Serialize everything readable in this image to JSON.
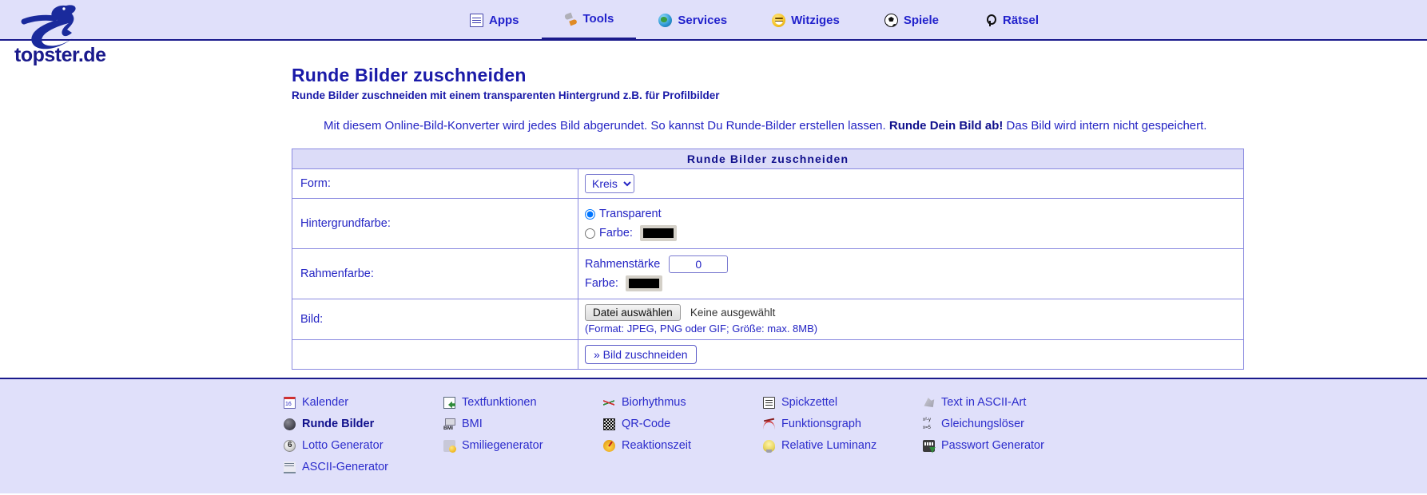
{
  "site": {
    "logo_text": "topster.de"
  },
  "nav": {
    "items": [
      {
        "label": "Apps",
        "icon": "apps-icon",
        "active": false
      },
      {
        "label": "Tools",
        "icon": "tools-icon",
        "active": true
      },
      {
        "label": "Services",
        "icon": "services-icon",
        "active": false
      },
      {
        "label": "Witziges",
        "icon": "smiley-icon",
        "active": false
      },
      {
        "label": "Spiele",
        "icon": "soccer-ball-icon",
        "active": false
      },
      {
        "label": "Rätsel",
        "icon": "puzzle-key-icon",
        "active": false
      }
    ]
  },
  "page": {
    "title": "Runde Bilder zuschneiden",
    "subtitle": "Runde Bilder zuschneiden mit einem transparenten Hintergrund z.B. für Profilbilder",
    "intro_part1": "Mit diesem Online-Bild-Konverter wird jedes Bild abgerundet. So kannst Du Runde-Bilder erstellen lassen. ",
    "intro_bold": "Runde Dein Bild ab!",
    "intro_part2": " Das Bild wird intern nicht gespeichert."
  },
  "form": {
    "header": "Runde Bilder zuschneiden",
    "rows": {
      "form": {
        "label": "Form:",
        "select_value": "Kreis",
        "options": [
          "Kreis"
        ]
      },
      "background": {
        "label": "Hintergrundfarbe:",
        "radio_transparent": "Transparent",
        "radio_farbe": "Farbe:",
        "color_value": "#000000",
        "selected": "transparent"
      },
      "border": {
        "label": "Rahmenfarbe:",
        "strength_label": "Rahmenstärke",
        "strength_value": "0",
        "color_label": "Farbe:",
        "color_value": "#000000"
      },
      "image": {
        "label": "Bild:",
        "file_button": "Datei auswählen",
        "file_status": "Keine ausgewählt",
        "hint": "(Format: JPEG, PNG oder GIF; Größe: max. 8MB)"
      }
    },
    "submit_label": "» Bild zuschneiden"
  },
  "footer": {
    "columns": [
      [
        {
          "label": "Kalender",
          "icon": "calendar-icon",
          "current": false
        },
        {
          "label": "Runde Bilder",
          "icon": "round-image-icon",
          "current": true
        },
        {
          "label": "Lotto Generator",
          "icon": "lotto-ball-icon",
          "current": false
        },
        {
          "label": "ASCII-Generator",
          "icon": "ascii-generator-icon",
          "current": false
        }
      ],
      [
        {
          "label": "Textfunktionen",
          "icon": "text-document-icon",
          "current": false
        },
        {
          "label": "BMI",
          "icon": "bmi-scale-icon",
          "current": false
        },
        {
          "label": "Smiliegenerator",
          "icon": "smilie-generator-icon",
          "current": false
        }
      ],
      [
        {
          "label": "Biorhythmus",
          "icon": "biorhythm-icon",
          "current": false
        },
        {
          "label": "QR-Code",
          "icon": "qr-code-icon",
          "current": false
        },
        {
          "label": "Reaktionszeit",
          "icon": "stopwatch-icon",
          "current": false
        }
      ],
      [
        {
          "label": "Spickzettel",
          "icon": "note-icon",
          "current": false
        },
        {
          "label": "Funktionsgraph",
          "icon": "graph-curve-icon",
          "current": false
        },
        {
          "label": "Relative Luminanz",
          "icon": "lightbulb-icon",
          "current": false
        }
      ],
      [
        {
          "label": "Text in ASCII-Art",
          "icon": "ascii-art-icon",
          "current": false
        },
        {
          "label": "Gleichungslöser",
          "icon": "equation-icon",
          "current": false
        },
        {
          "label": "Passwort Generator",
          "icon": "password-keyboard-icon",
          "current": false
        }
      ]
    ]
  },
  "colors": {
    "brand_dark": "#1a1a8c",
    "link_blue": "#2424c4",
    "band_bg": "#e0e0fa",
    "table_header_bg": "#dcdcf8"
  }
}
